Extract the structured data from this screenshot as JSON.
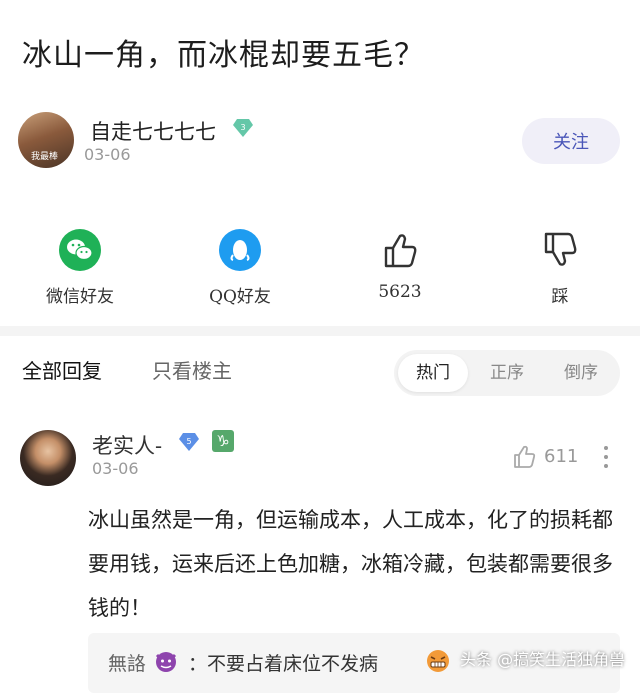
{
  "post": {
    "title": "冰山一角，而冰棍却要五毛？",
    "author": {
      "name": "自走七七七七",
      "level": "3",
      "date": "03-06",
      "avatar_text": "我最棒"
    },
    "follow_label": "关注"
  },
  "share_bar": {
    "wechat_label": "微信好友",
    "qq_label": "QQ好友",
    "like_count": "5623",
    "dislike_label": "踩"
  },
  "tabs": {
    "all_replies": "全部回复",
    "owner_only": "只看楼主",
    "sort_options": [
      "热门",
      "正序",
      "倒序"
    ],
    "active_sort": "热门"
  },
  "comment": {
    "name": "老实人-",
    "level": "5",
    "zodiac": "♑",
    "date": "03-06",
    "like_count": "611",
    "text": "冰山虽然是一角，但运输成本，人工成本，化了的损耗都要用钱，运来后还上色加糖，冰箱冷藏，包装都需要很多钱的！",
    "sub_reply": {
      "name": "無詻",
      "text": "：不要占着床位不发病"
    }
  },
  "watermark": "头条 @搞笑生活独角兽",
  "colors": {
    "follow_text": "#4a56b8",
    "wechat_green": "#1fb157",
    "qq_blue": "#1e9cf0",
    "level_badge": "#64c7a8"
  },
  "icons": [
    "wechat-icon",
    "qq-icon",
    "thumbs-up-icon",
    "thumbs-down-icon",
    "more-icon",
    "devil-emoji-icon",
    "angry-emoji-icon"
  ]
}
